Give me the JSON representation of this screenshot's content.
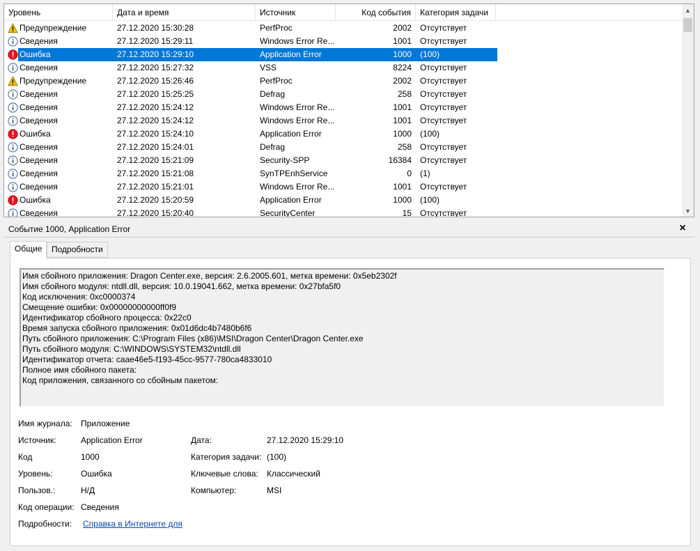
{
  "columns": {
    "level": "Уровень",
    "datetime": "Дата и время",
    "source": "Источник",
    "event_id": "Код события",
    "category": "Категория задачи"
  },
  "rows": [
    {
      "icon": "warning",
      "level": "Предупреждение",
      "datetime": "27.12.2020 15:30:28",
      "source": "PerfProc",
      "event_id": "2002",
      "category": "Отсутствует"
    },
    {
      "icon": "info",
      "level": "Сведения",
      "datetime": "27.12.2020 15:29:11",
      "source": "Windows Error Re...",
      "event_id": "1001",
      "category": "Отсутствует"
    },
    {
      "icon": "error",
      "level": "Ошибка",
      "datetime": "27.12.2020 15:29:10",
      "source": "Application Error",
      "event_id": "1000",
      "category": "(100)",
      "selected": true
    },
    {
      "icon": "info",
      "level": "Сведения",
      "datetime": "27.12.2020 15:27:32",
      "source": "VSS",
      "event_id": "8224",
      "category": "Отсутствует"
    },
    {
      "icon": "warning",
      "level": "Предупреждение",
      "datetime": "27.12.2020 15:26:46",
      "source": "PerfProc",
      "event_id": "2002",
      "category": "Отсутствует"
    },
    {
      "icon": "info",
      "level": "Сведения",
      "datetime": "27.12.2020 15:25:25",
      "source": "Defrag",
      "event_id": "258",
      "category": "Отсутствует"
    },
    {
      "icon": "info",
      "level": "Сведения",
      "datetime": "27.12.2020 15:24:12",
      "source": "Windows Error Re...",
      "event_id": "1001",
      "category": "Отсутствует"
    },
    {
      "icon": "info",
      "level": "Сведения",
      "datetime": "27.12.2020 15:24:12",
      "source": "Windows Error Re...",
      "event_id": "1001",
      "category": "Отсутствует"
    },
    {
      "icon": "error",
      "level": "Ошибка",
      "datetime": "27.12.2020 15:24:10",
      "source": "Application Error",
      "event_id": "1000",
      "category": "(100)"
    },
    {
      "icon": "info",
      "level": "Сведения",
      "datetime": "27.12.2020 15:24:01",
      "source": "Defrag",
      "event_id": "258",
      "category": "Отсутствует"
    },
    {
      "icon": "info",
      "level": "Сведения",
      "datetime": "27.12.2020 15:21:09",
      "source": "Security-SPP",
      "event_id": "16384",
      "category": "Отсутствует"
    },
    {
      "icon": "info",
      "level": "Сведения",
      "datetime": "27.12.2020 15:21:08",
      "source": "SynTPEnhService",
      "event_id": "0",
      "category": "(1)"
    },
    {
      "icon": "info",
      "level": "Сведения",
      "datetime": "27.12.2020 15:21:01",
      "source": "Windows Error Re...",
      "event_id": "1001",
      "category": "Отсутствует"
    },
    {
      "icon": "error",
      "level": "Ошибка",
      "datetime": "27.12.2020 15:20:59",
      "source": "Application Error",
      "event_id": "1000",
      "category": "(100)"
    },
    {
      "icon": "info",
      "level": "Сведения",
      "datetime": "27.12.2020 15:20:40",
      "source": "SecurityCenter",
      "event_id": "15",
      "category": "Отсутствует"
    }
  ],
  "detail": {
    "title": "Событие 1000, Application Error",
    "close_glyph": "×",
    "tabs": {
      "general": "Общие",
      "details": "Подробности"
    },
    "description": [
      "Имя сбойного приложения: Dragon Center.exe, версия: 2.6.2005.601, метка времени: 0x5eb2302f",
      "Имя сбойного модуля: ntdll.dll, версия: 10.0.19041.662, метка времени: 0x27bfa5f0",
      "Код исключения: 0xc0000374",
      "Смещение ошибки: 0x00000000000ff0f9",
      "Идентификатор сбойного процесса: 0x22c0",
      "Время запуска сбойного приложения: 0x01d6dc4b7480b6f6",
      "Путь сбойного приложения: C:\\Program Files (x86)\\MSI\\Dragon Center\\Dragon Center.exe",
      "Путь сбойного модуля: C:\\WINDOWS\\SYSTEM32\\ntdll.dll",
      "Идентификатор отчета: caae46e5-f193-45cc-9577-780ca4833010",
      "Полное имя сбойного пакета:",
      "Код приложения, связанного со сбойным пакетом:"
    ],
    "fields": {
      "log_name_label": "Имя журнала:",
      "log_name": "Приложение",
      "source_label": "Источник:",
      "source": "Application Error",
      "date_label": "Дата:",
      "date": "27.12.2020 15:29:10",
      "code_label": "Код",
      "code": "1000",
      "category_label": "Категория задачи:",
      "category": "(100)",
      "level_label": "Уровень:",
      "level": "Ошибка",
      "keywords_label": "Ключевые слова:",
      "keywords": "Классический",
      "user_label": "Пользов.:",
      "user": "Н/Д",
      "computer_label": "Компьютер:",
      "computer": "MSI",
      "opcode_label": "Код операции:",
      "opcode": "Сведения",
      "more_info_label": "Подробности:",
      "more_info_link": "Справка в Интернете для "
    }
  },
  "colors": {
    "selection": "#0078d7",
    "warning": "#f5c400",
    "error": "#e81123",
    "info_ring": "#4a6fa5"
  }
}
